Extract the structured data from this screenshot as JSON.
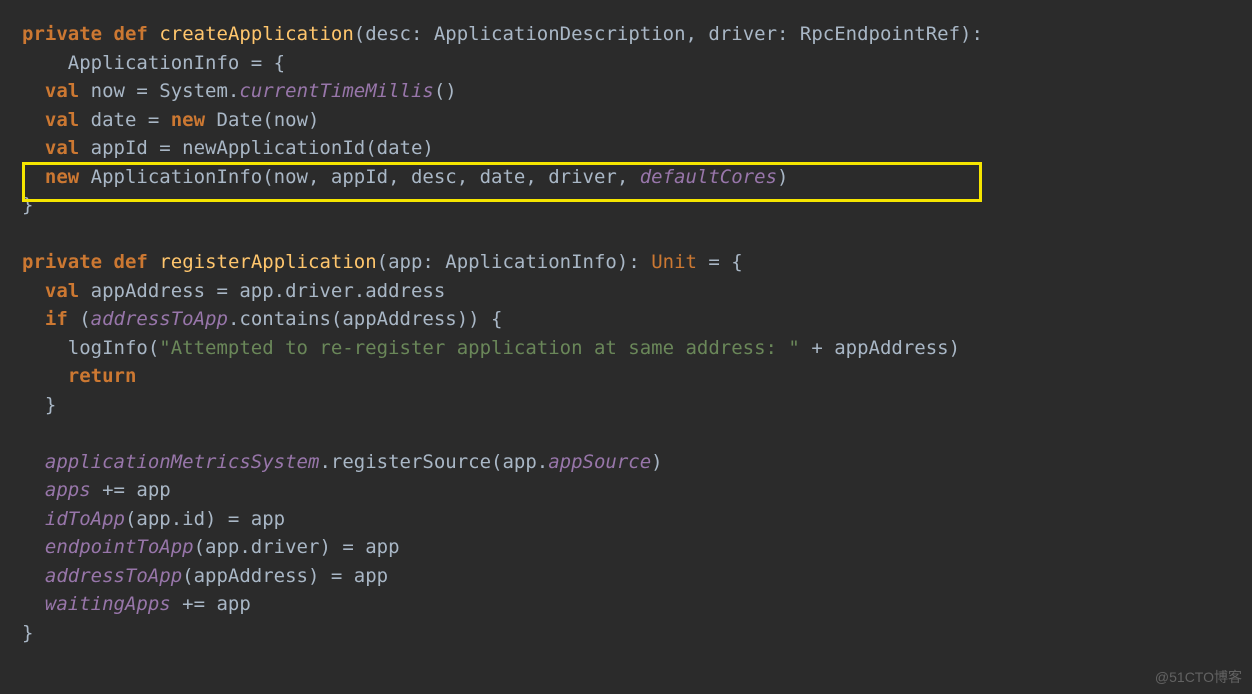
{
  "code": {
    "l1": {
      "p1": "private",
      "p2": "def",
      "p3": "createApplication",
      "p4": "(desc: ApplicationDescription, driver: RpcEndpointRef):"
    },
    "l2": {
      "p1": "    ApplicationInfo = {"
    },
    "l3": {
      "p1": "val",
      "p2": " now = System.",
      "p3": "currentTimeMillis",
      "p4": "()"
    },
    "l4": {
      "p1": "val",
      "p2": " date = ",
      "p3": "new",
      "p4": " Date(now)"
    },
    "l5": {
      "p1": "val",
      "p2": " appId = newApplicationId(date)"
    },
    "l6": {
      "p1": "new",
      "p2": " ApplicationInfo(now, appId, desc, date, driver, ",
      "p3": "defaultCores",
      "p4": ")"
    },
    "l7": {
      "p1": "}"
    },
    "blank": "",
    "l8": {
      "p1": "private",
      "p2": "def",
      "p3": "registerApplication",
      "p4": "(app: ApplicationInfo): ",
      "p5": "Unit",
      "p6": " = {"
    },
    "l9": {
      "p1": "val",
      "p2": " appAddress = app.driver.address"
    },
    "l10": {
      "p1": "if",
      "p2": " (",
      "p3": "addressToApp",
      "p4": ".contains(appAddress)) {"
    },
    "l11": {
      "p1": "    logInfo(",
      "p2": "\"Attempted to re-register application at same address: \"",
      "p3": " + appAddress)"
    },
    "l12": {
      "p1": "return"
    },
    "l13": {
      "p1": "  }"
    },
    "l14": {
      "p1": "applicationMetricsSystem",
      "p2": ".registerSource(app.",
      "p3": "appSource",
      "p4": ")"
    },
    "l15": {
      "p1": "apps",
      "p2": " += app"
    },
    "l16": {
      "p1": "idToApp",
      "p2": "(app.id) = app"
    },
    "l17": {
      "p1": "endpointToApp",
      "p2": "(app.driver) = app"
    },
    "l18": {
      "p1": "addressToApp",
      "p2": "(appAddress) = app"
    },
    "l19": {
      "p1": "waitingApps",
      "p2": " += app"
    },
    "l20": {
      "p1": "}"
    }
  },
  "watermark": "@51CTO博客"
}
